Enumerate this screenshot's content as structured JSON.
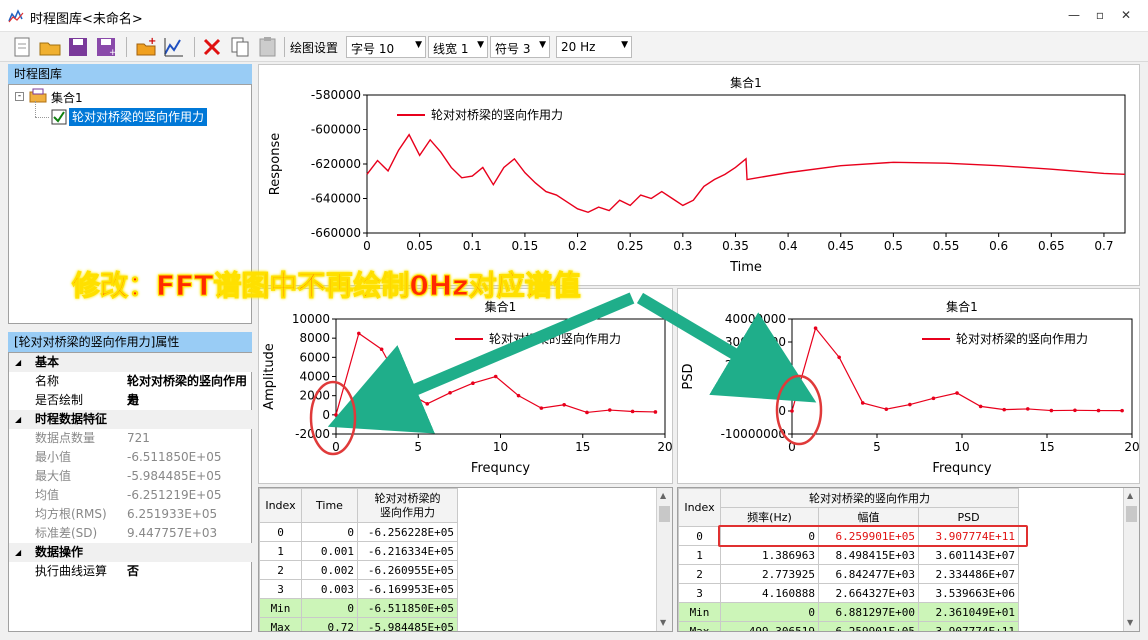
{
  "window": {
    "title": "时程图库<未命名>"
  },
  "toolbar": {
    "plot_settings_label": "绘图设置",
    "font_size": "字号 10",
    "line_width": "线宽 1",
    "symbol": "符号 3",
    "freq": "20 Hz"
  },
  "tree": {
    "header": "时程图库",
    "group": "集合1",
    "item": "轮对对桥梁的竖向作用力"
  },
  "props": {
    "header": "[轮对对桥梁的竖向作用力]属性",
    "sections": [
      {
        "title": "基本",
        "rows": [
          {
            "k": "名称",
            "v": "轮对对桥梁的竖向作用力"
          },
          {
            "k": "是否绘制",
            "v": "是"
          }
        ]
      },
      {
        "title": "时程数据特征",
        "rows": [
          {
            "k": "数据点数量",
            "v": "721"
          },
          {
            "k": "最小值",
            "v": "-6.511850E+05"
          },
          {
            "k": "最大值",
            "v": "-5.984485E+05"
          },
          {
            "k": "均值",
            "v": "-6.251219E+05"
          },
          {
            "k": "均方根(RMS)",
            "v": "6.251933E+05"
          },
          {
            "k": "标准差(SD)",
            "v": "9.447757E+03"
          }
        ]
      },
      {
        "title": "数据操作",
        "rows": [
          {
            "k": "执行曲线运算",
            "v": "否"
          }
        ]
      }
    ]
  },
  "annotation": {
    "text": "修改：FFT谱图中不再绘制0Hz对应谱值"
  },
  "charts": {
    "top": {
      "title": "集合1",
      "xlabel": "Time",
      "ylabel": "Response",
      "legend": "轮对对桥梁的竖向作用力"
    },
    "amp": {
      "title": "集合1",
      "xlabel": "Frequncy",
      "ylabel": "Amplitude",
      "legend": "轮对对桥梁的竖向作用力"
    },
    "psd": {
      "title": "集合1",
      "xlabel": "Frequncy",
      "ylabel": "PSD",
      "legend": "轮对对桥梁的竖向作用力"
    }
  },
  "chart_data": [
    {
      "type": "line",
      "title": "集合1",
      "xlabel": "Time",
      "ylabel": "Response",
      "xlim": [
        0,
        0.72
      ],
      "ylim": [
        -660000,
        -580000
      ],
      "xticks": [
        "0",
        "0.05",
        "0.1",
        "0.15",
        "0.2",
        "0.25",
        "0.3",
        "0.35",
        "0.4",
        "0.45",
        "0.5",
        "0.55",
        "0.6",
        "0.65",
        "0.7"
      ],
      "yticks": [
        "-580000",
        "-600000",
        "-620000",
        "-640000",
        "-660000"
      ],
      "series": [
        {
          "name": "轮对对桥梁的竖向作用力",
          "color": "#e8001c",
          "x": [
            0,
            0.01,
            0.02,
            0.03,
            0.04,
            0.05,
            0.06,
            0.07,
            0.08,
            0.09,
            0.1,
            0.11,
            0.12,
            0.13,
            0.14,
            0.15,
            0.16,
            0.17,
            0.18,
            0.19,
            0.2,
            0.21,
            0.22,
            0.23,
            0.24,
            0.25,
            0.26,
            0.27,
            0.28,
            0.29,
            0.3,
            0.31,
            0.32,
            0.33,
            0.34,
            0.35,
            0.36,
            0.361,
            0.4,
            0.45,
            0.5,
            0.55,
            0.6,
            0.65,
            0.7,
            0.72
          ],
          "y": [
            -626000,
            -618000,
            -624000,
            -612000,
            -603000,
            -615000,
            -606000,
            -613000,
            -622000,
            -628000,
            -627000,
            -622000,
            -632000,
            -622000,
            -617000,
            -625000,
            -631000,
            -636000,
            -638000,
            -642000,
            -646000,
            -648000,
            -645000,
            -647000,
            -641000,
            -644000,
            -638000,
            -640000,
            -636000,
            -640000,
            -644000,
            -641000,
            -633000,
            -629000,
            -626000,
            -622000,
            -617000,
            -629000,
            -625000,
            -621000,
            -619000,
            -619500,
            -621000,
            -623000,
            -625500,
            -626000
          ]
        }
      ]
    },
    {
      "type": "line",
      "title": "集合1",
      "xlabel": "Frequncy",
      "ylabel": "Amplitude",
      "xlim": [
        0,
        20
      ],
      "ylim": [
        -2000,
        10000
      ],
      "xticks": [
        "0",
        "5",
        "10",
        "15",
        "20"
      ],
      "yticks": [
        "10000",
        "8000",
        "6000",
        "4000",
        "2000",
        "0",
        "-2000"
      ],
      "series": [
        {
          "name": "轮对对桥梁的竖向作用力",
          "color": "#e8001c",
          "x": [
            0,
            1.386963,
            2.773925,
            4.160888,
            5.54785,
            6.934813,
            8.321776,
            9.708738,
            11.0957,
            12.482663,
            13.869626,
            15.256588,
            16.643551,
            18.030513,
            19.417476
          ],
          "y": [
            0,
            8498.415,
            6842.477,
            2500,
            1150,
            2300,
            3300,
            4000,
            2000,
            700,
            1050,
            250,
            500,
            350,
            300
          ]
        }
      ]
    },
    {
      "type": "line",
      "title": "集合1",
      "xlabel": "Frequncy",
      "ylabel": "PSD",
      "xlim": [
        0,
        20
      ],
      "ylim": [
        -10000000,
        40000000
      ],
      "xticks": [
        "0",
        "5",
        "10",
        "15",
        "20"
      ],
      "yticks": [
        "40000000",
        "30000000",
        "20000000",
        "10000000",
        "0",
        "-10000000"
      ],
      "series": [
        {
          "name": "轮对对桥梁的竖向作用力",
          "color": "#e8001c",
          "x": [
            0,
            1.386963,
            2.773925,
            4.160888,
            5.54785,
            6.934813,
            8.321776,
            9.708738,
            11.0957,
            12.482663,
            13.869626,
            15.256588,
            16.643551,
            18.030513,
            19.417476
          ],
          "y": [
            0,
            36011430,
            23344860,
            3500000,
            800000,
            2800000,
            5500000,
            7800000,
            2000000,
            600000,
            900000,
            200000,
            300000,
            200000,
            150000
          ]
        }
      ]
    }
  ],
  "table_left": {
    "headers": [
      "Index",
      "Time",
      "轮对对桥梁的\n竖向作用力"
    ],
    "rows": [
      [
        "0",
        "0",
        "-6.256228E+05"
      ],
      [
        "1",
        "0.001",
        "-6.216334E+05"
      ],
      [
        "2",
        "0.002",
        "-6.260955E+05"
      ],
      [
        "3",
        "0.003",
        "-6.169953E+05"
      ]
    ],
    "stats": [
      [
        "Min",
        "0",
        "-6.511850E+05"
      ],
      [
        "Max",
        "0.72",
        "-5.984485E+05"
      ]
    ]
  },
  "table_right": {
    "group_header": "轮对对桥梁的竖向作用力",
    "headers": [
      "Index",
      "频率(Hz)",
      "幅值",
      "PSD"
    ],
    "rows": [
      [
        "0",
        "0",
        "6.259901E+05",
        "3.907774E+11"
      ],
      [
        "1",
        "1.386963",
        "8.498415E+03",
        "3.601143E+07"
      ],
      [
        "2",
        "2.773925",
        "6.842477E+03",
        "2.334486E+07"
      ],
      [
        "3",
        "4.160888",
        "2.664327E+03",
        "3.539663E+06"
      ]
    ],
    "stats": [
      [
        "Min",
        "0",
        "6.881297E+00",
        "2.361049E+01"
      ],
      [
        "Max",
        "499.306519",
        "6.259901E+05",
        "3.907774E+11"
      ]
    ]
  }
}
